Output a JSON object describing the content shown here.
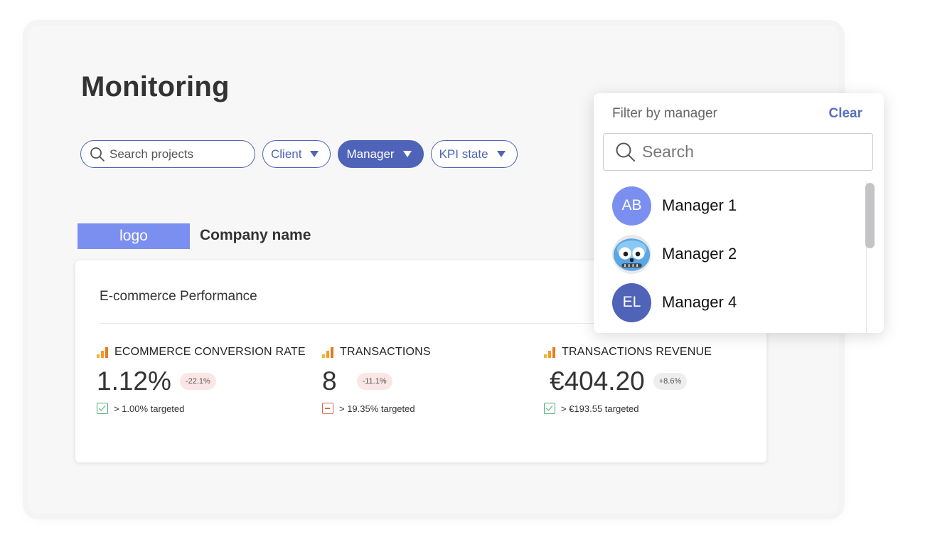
{
  "page": {
    "title": "Monitoring"
  },
  "filters": {
    "search_placeholder": "Search projects",
    "chips": [
      {
        "label": "Client",
        "active": false
      },
      {
        "label": "Manager",
        "active": true
      },
      {
        "label": "KPI state",
        "active": false
      }
    ]
  },
  "company": {
    "logo_text": "logo",
    "name": "Company name"
  },
  "card": {
    "title": "E-commerce Performance",
    "metrics": [
      {
        "label": "ECOMMERCE CONVERSION RATE",
        "value": "1.12%",
        "delta": "-22.1%",
        "delta_tone": "negative",
        "target_status": "met",
        "target": "> 1.00% targeted"
      },
      {
        "label": "TRANSACTIONS",
        "value": "8",
        "delta": "-11.1%",
        "delta_tone": "negative",
        "target_status": "not-met",
        "target": "> 19.35% targeted"
      },
      {
        "label": "TRANSACTIONS REVENUE",
        "value": "€404.20",
        "delta": "+8.6%",
        "delta_tone": "neutral",
        "target_status": "met",
        "target": "> €193.55 targeted"
      }
    ]
  },
  "dropdown": {
    "header": "Filter by manager",
    "clear_label": "Clear",
    "search_placeholder": "Search",
    "items": [
      {
        "initials": "AB",
        "name": "Manager 1",
        "avatar_color": "#7b8ff0"
      },
      {
        "initials": "",
        "name": "Manager 2",
        "avatar_type": "image"
      },
      {
        "initials": "EL",
        "name": "Manager 4",
        "avatar_color": "#4f63b8"
      }
    ]
  },
  "colors": {
    "accent": "#4f63b8",
    "logo_bg": "#7b8ff0",
    "negative_badge": "#fbe6e6",
    "check_green": "#4caf72",
    "miss_red": "#d56a4f",
    "analytics_orange": "#f19c28"
  }
}
